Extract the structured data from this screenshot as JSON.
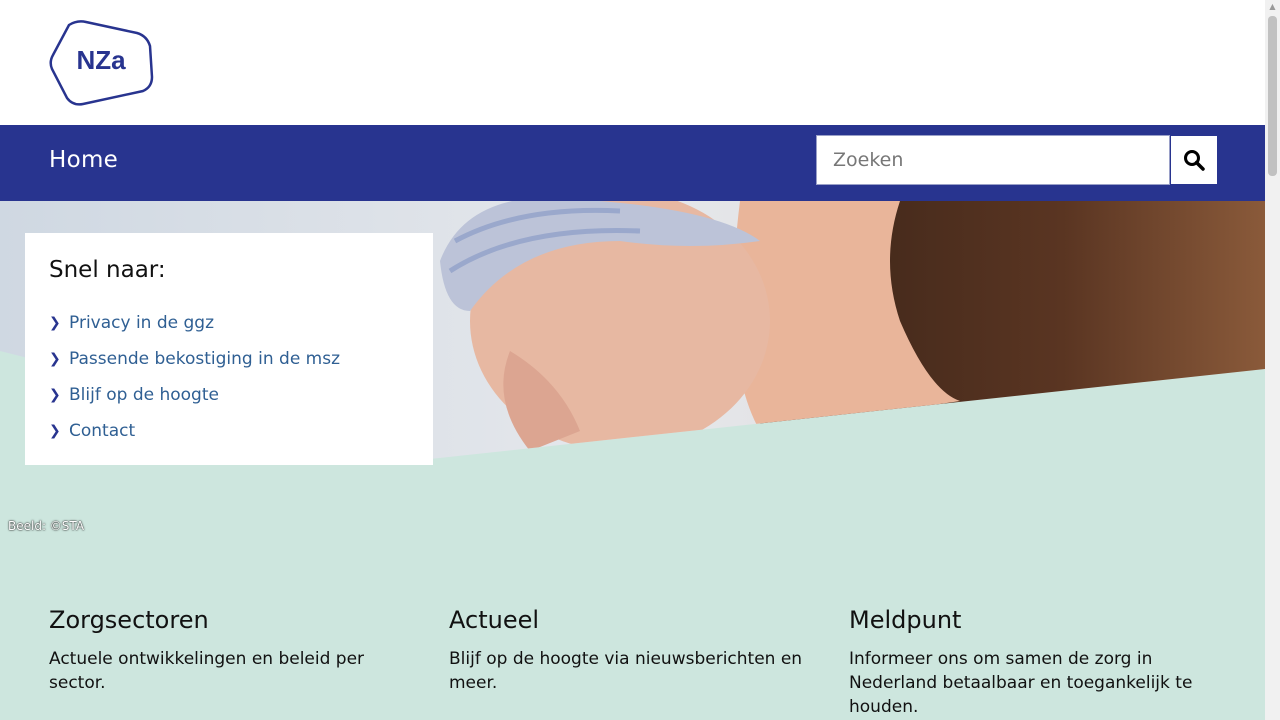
{
  "header": {
    "logo_text": "NZa"
  },
  "nav": {
    "home_label": "Home"
  },
  "search": {
    "placeholder": "Zoeken",
    "button_icon": "search-icon"
  },
  "quicklinks": {
    "title": "Snel naar:",
    "items": [
      {
        "label": "Privacy in de ggz"
      },
      {
        "label": "Passende bekostiging in de msz"
      },
      {
        "label": "Blijf op de hoogte"
      },
      {
        "label": "Contact"
      }
    ]
  },
  "hero": {
    "credit": "Beeld: ©STA"
  },
  "columns": [
    {
      "title": "Zorgsectoren",
      "text": "Actuele ontwikkelingen en beleid per sector."
    },
    {
      "title": "Actueel",
      "text": "Blijf op de hoogte via nieuwsberichten en meer."
    },
    {
      "title": "Meldpunt",
      "text": "Informeer ons om samen de zorg in Nederland betaalbaar en toegankelijk te houden."
    }
  ],
  "colors": {
    "brand": "#28348f",
    "mint": "#cde6de",
    "link": "#2f5f93"
  }
}
